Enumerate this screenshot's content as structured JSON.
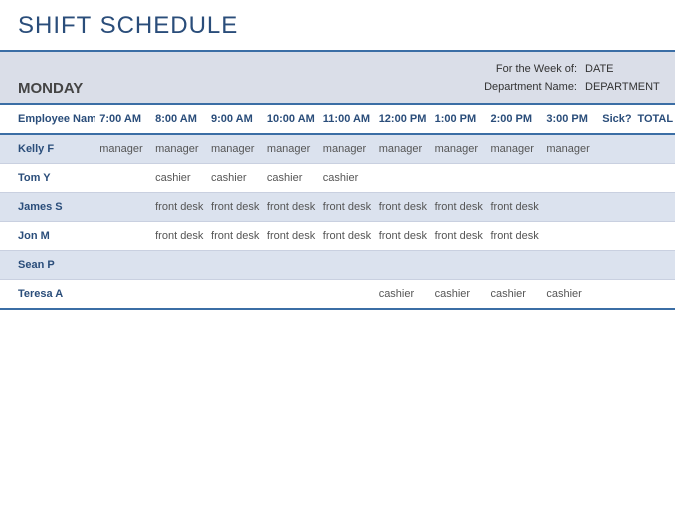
{
  "title": "SHIFT SCHEDULE",
  "day": "MONDAY",
  "info": {
    "week_label": "For the Week of:",
    "week_value": "DATE",
    "dept_label": "Department Name:",
    "dept_value": "DEPARTMENT"
  },
  "headers": {
    "name": "Employee Name",
    "times": [
      "7:00 AM",
      "8:00 AM",
      "9:00 AM",
      "10:00 AM",
      "11:00 AM",
      "12:00 PM",
      "1:00 PM",
      "2:00 PM",
      "3:00 PM"
    ],
    "sick": "Sick?",
    "total": "TOTAL"
  },
  "rows": [
    {
      "name": "Kelly F",
      "shade": true,
      "cells": [
        "manager",
        "manager",
        "manager",
        "manager",
        "manager",
        "manager",
        "manager",
        "manager",
        "manager"
      ]
    },
    {
      "name": "Tom Y",
      "shade": false,
      "cells": [
        "",
        "cashier",
        "cashier",
        "cashier",
        "cashier",
        "",
        "",
        "",
        ""
      ]
    },
    {
      "name": "James S",
      "shade": true,
      "cells": [
        "",
        "front desk",
        "front desk",
        "front desk",
        "front desk",
        "front desk",
        "front desk",
        "front desk",
        ""
      ]
    },
    {
      "name": "Jon M",
      "shade": false,
      "cells": [
        "",
        "front desk",
        "front desk",
        "front desk",
        "front desk",
        "front desk",
        "front desk",
        "front desk",
        ""
      ]
    },
    {
      "name": "Sean P",
      "shade": true,
      "cells": [
        "",
        "",
        "",
        "",
        "",
        "",
        "",
        "",
        ""
      ]
    },
    {
      "name": "Teresa A",
      "shade": false,
      "cells": [
        "",
        "",
        "",
        "",
        "",
        "cashier",
        "cashier",
        "cashier",
        "cashier"
      ]
    }
  ]
}
